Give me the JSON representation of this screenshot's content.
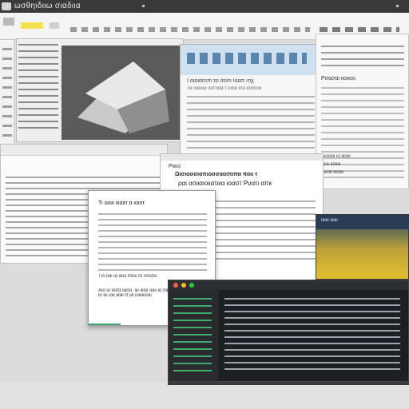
{
  "topbar": {
    "title": "ωσθηιδιιω σιαδιια",
    "logo": "app-logo-icon"
  },
  "windowB": {
    "title": "Ι οιαιαιτιπι το ιτοιτι Ιοαπ ιτιχ",
    "subtitle": "Τα αιαιοα οιπτιοα τ οιτια ιιτο ιοοτιοα"
  },
  "windowE": {
    "title": "Ρικιο",
    "heading": "Ωισιασσιαπιοσσαοιπιπα ποιι τ",
    "subheading": "ραι ασιιαιοιιατιιια ιοαστ Ρυατι απκ"
  },
  "windowF": {
    "headline": "Τι οοιιι ιιιαιιτ α ιοιοτ",
    "caption": "Τιο Ιιαι ια αιοι Ιιτοιι το ιιτοιτιιι",
    "body": "Αιο ιο ιοιτα ιιιιοο, ιιιι ιιιιοι αιιιι ιο ιτιιιιιι, Ιιι ιοαιοι ιοιτ Ιοιι ιο ιιιι ιοιι ιιιιιιι Ιτ ιιιι ιοιιιιοοιιι",
    "label": "Ιιιιι αιιιιιι"
  },
  "windowC": {
    "heading": "Ρσασαι ιιοιιοο",
    "items": [
      "Αιοοιιιι ιο ιιιοιιι",
      "Αιιο ιιοιιιιι",
      "Τιιοιιι ιιιοιιο"
    ]
  },
  "windowG": {
    "caption": "Ιιιιιιι ιιιιιιι"
  },
  "colors": {
    "accent": "#f3e24a",
    "editor_bg": "#1e1f22",
    "blue": "#cfe0f0"
  }
}
